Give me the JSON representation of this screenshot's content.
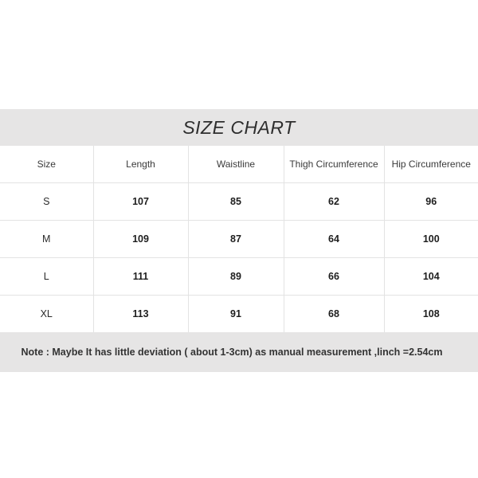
{
  "title": "SIZE CHART",
  "table": {
    "headers": [
      "Size",
      "Length",
      "Waistline",
      "Thigh Circumference",
      "Hip Circumference"
    ],
    "rows": [
      {
        "size": "S",
        "length": "107",
        "waistline": "85",
        "thigh": "62",
        "hip": "96"
      },
      {
        "size": "M",
        "length": "109",
        "waistline": "87",
        "thigh": "64",
        "hip": "100"
      },
      {
        "size": "L",
        "length": "111",
        "waistline": "89",
        "thigh": "66",
        "hip": "104"
      },
      {
        "size": "XL",
        "length": "113",
        "waistline": "91",
        "thigh": "68",
        "hip": "108"
      }
    ]
  },
  "note": "Note : Maybe It has little deviation ( about 1-3cm) as manual measurement ,linch =2.54cm",
  "colors": {
    "band_background": "#e6e5e5",
    "page_background": "#ffffff",
    "grid_line": "#e3e3e3",
    "title_text": "#2e2e2e",
    "value_text": "#1e1e1e",
    "header_text": "#3a3a3a",
    "note_text": "#333333"
  },
  "chart_data": {
    "type": "table",
    "title": "SIZE CHART",
    "columns": [
      "Size",
      "Length",
      "Waistline",
      "Thigh Circumference",
      "Hip Circumference"
    ],
    "units": "cm",
    "rows": [
      [
        "S",
        107,
        85,
        62,
        96
      ],
      [
        "M",
        109,
        87,
        64,
        100
      ],
      [
        "L",
        111,
        89,
        66,
        104
      ],
      [
        "XL",
        113,
        91,
        68,
        108
      ]
    ],
    "annotations": [
      "Note : Maybe It has little deviation ( about 1-3cm) as manual measurement ,linch =2.54cm"
    ]
  }
}
